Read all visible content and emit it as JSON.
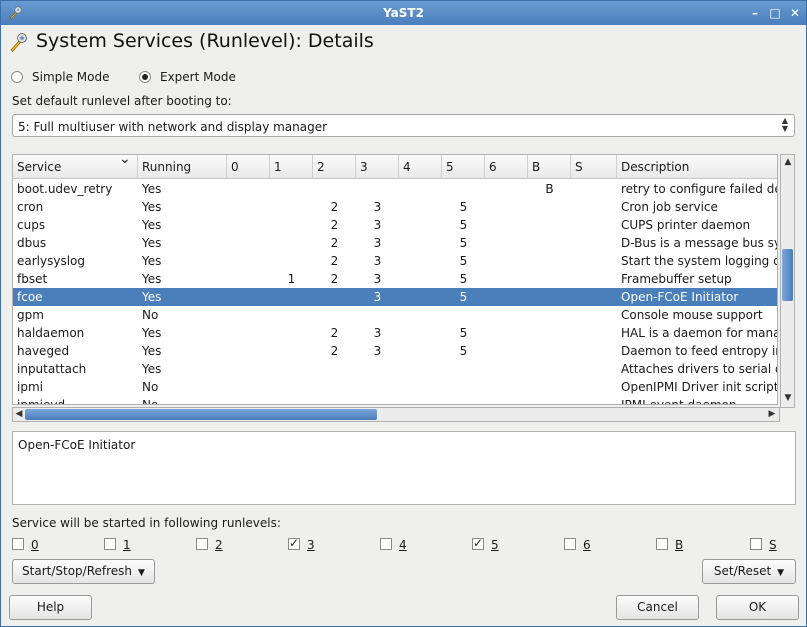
{
  "window": {
    "title": "YaST2",
    "controls": {
      "minimize": "–",
      "maximize": "□",
      "close": "✕"
    }
  },
  "heading": {
    "icon": "wrench-icon",
    "text": "System Services (Runlevel): Details"
  },
  "mode": {
    "simple": {
      "label": "Simple Mode",
      "selected": false
    },
    "expert": {
      "label": "Expert Mode",
      "selected": true
    }
  },
  "default_runlevel": {
    "label": "Set default runlevel after booting to:",
    "value": "5: Full multiuser with network and display manager"
  },
  "table": {
    "columns": [
      "Service",
      "Running",
      "0",
      "1",
      "2",
      "3",
      "4",
      "5",
      "6",
      "B",
      "S",
      "Description"
    ],
    "rows": [
      {
        "service": "boot.udev_retry",
        "running": "Yes",
        "r0": "",
        "r1": "",
        "r2": "",
        "r3": "",
        "r4": "",
        "r5": "",
        "r6": "",
        "rB": "B",
        "rS": "",
        "description": "retry to configure failed devi"
      },
      {
        "service": "cron",
        "running": "Yes",
        "r0": "",
        "r1": "",
        "r2": "2",
        "r3": "3",
        "r4": "",
        "r5": "5",
        "r6": "",
        "rB": "",
        "rS": "",
        "description": "Cron job service"
      },
      {
        "service": "cups",
        "running": "Yes",
        "r0": "",
        "r1": "",
        "r2": "2",
        "r3": "3",
        "r4": "",
        "r5": "5",
        "r6": "",
        "rB": "",
        "rS": "",
        "description": "CUPS printer daemon"
      },
      {
        "service": "dbus",
        "running": "Yes",
        "r0": "",
        "r1": "",
        "r2": "2",
        "r3": "3",
        "r4": "",
        "r5": "5",
        "r6": "",
        "rB": "",
        "rS": "",
        "description": "D-Bus is a message bus sy"
      },
      {
        "service": "earlysyslog",
        "running": "Yes",
        "r0": "",
        "r1": "",
        "r2": "2",
        "r3": "3",
        "r4": "",
        "r5": "5",
        "r6": "",
        "rB": "",
        "rS": "",
        "description": "Start the system logging da"
      },
      {
        "service": "fbset",
        "running": "Yes",
        "r0": "",
        "r1": "1",
        "r2": "2",
        "r3": "3",
        "r4": "",
        "r5": "5",
        "r6": "",
        "rB": "",
        "rS": "",
        "description": "Framebuffer setup"
      },
      {
        "service": "fcoe",
        "running": "Yes",
        "r0": "",
        "r1": "",
        "r2": "",
        "r3": "3",
        "r4": "",
        "r5": "5",
        "r6": "",
        "rB": "",
        "rS": "",
        "description": "Open-FCoE Initiator",
        "selected": true
      },
      {
        "service": "gpm",
        "running": "No",
        "r0": "",
        "r1": "",
        "r2": "",
        "r3": "",
        "r4": "",
        "r5": "",
        "r6": "",
        "rB": "",
        "rS": "",
        "description": "Console mouse support"
      },
      {
        "service": "haldaemon",
        "running": "Yes",
        "r0": "",
        "r1": "",
        "r2": "2",
        "r3": "3",
        "r4": "",
        "r5": "5",
        "r6": "",
        "rB": "",
        "rS": "",
        "description": "HAL is a daemon for manag"
      },
      {
        "service": "haveged",
        "running": "Yes",
        "r0": "",
        "r1": "",
        "r2": "2",
        "r3": "3",
        "r4": "",
        "r5": "5",
        "r6": "",
        "rB": "",
        "rS": "",
        "description": "Daemon to feed entropy int"
      },
      {
        "service": "inputattach",
        "running": "Yes",
        "r0": "",
        "r1": "",
        "r2": "",
        "r3": "",
        "r4": "",
        "r5": "",
        "r6": "",
        "rB": "",
        "rS": "",
        "description": "Attaches drivers to serial de"
      },
      {
        "service": "ipmi",
        "running": "No",
        "r0": "",
        "r1": "",
        "r2": "",
        "r3": "",
        "r4": "",
        "r5": "",
        "r6": "",
        "rB": "",
        "rS": "",
        "description": "OpenIPMI Driver init script"
      },
      {
        "service": "ipmievd",
        "running": "No",
        "r0": "",
        "r1": "",
        "r2": "",
        "r3": "",
        "r4": "",
        "r5": "",
        "r6": "",
        "rB": "",
        "rS": "",
        "description": "IPMI event daemon"
      }
    ]
  },
  "description_text": "Open-FCoE Initiator",
  "runlevels": {
    "label": "Service will be started in following runlevels:",
    "items": [
      {
        "label": "0",
        "checked": false
      },
      {
        "label": "1",
        "checked": false
      },
      {
        "label": "2",
        "checked": false
      },
      {
        "label": "3",
        "checked": true
      },
      {
        "label": "4",
        "checked": false
      },
      {
        "label": "5",
        "checked": true
      },
      {
        "label": "6",
        "checked": false
      },
      {
        "label": "B",
        "checked": false
      },
      {
        "label": "S",
        "checked": false
      }
    ]
  },
  "buttons": {
    "start_stop": "Start/Stop/Refresh",
    "set_reset": "Set/Reset",
    "help": "Help",
    "cancel": "Cancel",
    "ok": "OK"
  },
  "colors": {
    "titlebar": "#4a7fbc",
    "selection": "#4a7fbc"
  }
}
